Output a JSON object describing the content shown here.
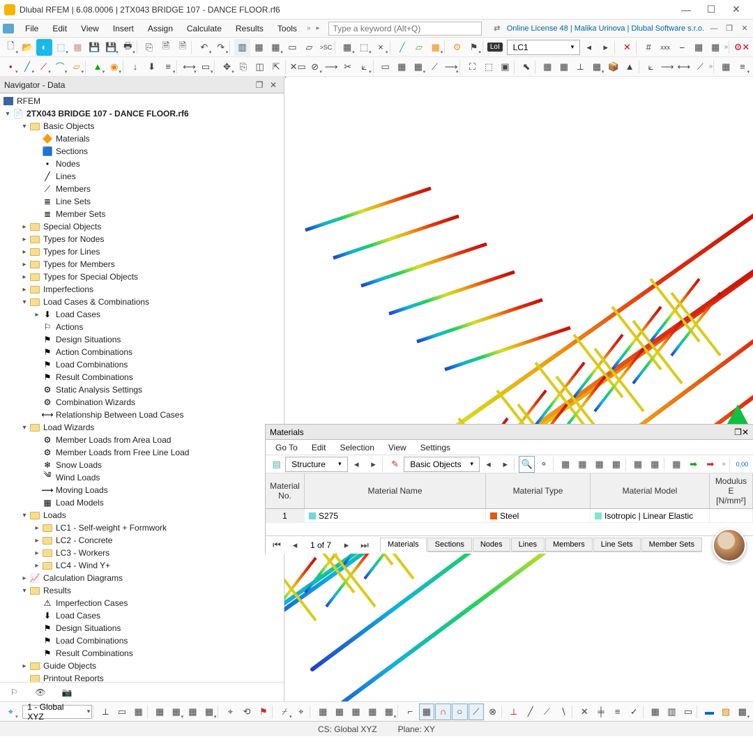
{
  "title": "Dlubal RFEM | 6.08.0006 | 2TX043 BRIDGE 107 - DANCE FLOOR.rf6",
  "menus": [
    "File",
    "Edit",
    "View",
    "Insert",
    "Assign",
    "Calculate",
    "Results",
    "Tools"
  ],
  "search_placeholder": "Type a keyword (Alt+Q)",
  "license": "Online License 48 | Malika Urinova | Dlubal Software s.r.o.",
  "lc_combo": "LC1",
  "navigator": {
    "title": "Navigator - Data",
    "root": "RFEM",
    "project": "2TX043 BRIDGE 107 - DANCE FLOOR.rf6",
    "tree": [
      {
        "d": 1,
        "tw": "▾",
        "ic": "folder",
        "t": "Basic Objects"
      },
      {
        "d": 2,
        "tw": "",
        "ic": "mat",
        "t": "Materials"
      },
      {
        "d": 2,
        "tw": "",
        "ic": "sec",
        "t": "Sections"
      },
      {
        "d": 2,
        "tw": "",
        "ic": "node",
        "t": "Nodes"
      },
      {
        "d": 2,
        "tw": "",
        "ic": "line",
        "t": "Lines"
      },
      {
        "d": 2,
        "tw": "",
        "ic": "memb",
        "t": "Members"
      },
      {
        "d": 2,
        "tw": "",
        "ic": "lset",
        "t": "Line Sets"
      },
      {
        "d": 2,
        "tw": "",
        "ic": "mset",
        "t": "Member Sets"
      },
      {
        "d": 1,
        "tw": "▸",
        "ic": "folder",
        "t": "Special Objects"
      },
      {
        "d": 1,
        "tw": "▸",
        "ic": "folder",
        "t": "Types for Nodes"
      },
      {
        "d": 1,
        "tw": "▸",
        "ic": "folder",
        "t": "Types for Lines"
      },
      {
        "d": 1,
        "tw": "▸",
        "ic": "folder",
        "t": "Types for Members"
      },
      {
        "d": 1,
        "tw": "▸",
        "ic": "folder",
        "t": "Types for Special Objects"
      },
      {
        "d": 1,
        "tw": "▸",
        "ic": "folder",
        "t": "Imperfections"
      },
      {
        "d": 1,
        "tw": "▾",
        "ic": "folder",
        "t": "Load Cases & Combinations"
      },
      {
        "d": 2,
        "tw": "▸",
        "ic": "lc",
        "t": "Load Cases"
      },
      {
        "d": 2,
        "tw": "",
        "ic": "act",
        "t": "Actions"
      },
      {
        "d": 2,
        "tw": "",
        "ic": "ds",
        "t": "Design Situations"
      },
      {
        "d": 2,
        "tw": "",
        "ic": "ac",
        "t": "Action Combinations"
      },
      {
        "d": 2,
        "tw": "",
        "ic": "lcomb",
        "t": "Load Combinations"
      },
      {
        "d": 2,
        "tw": "",
        "ic": "rc",
        "t": "Result Combinations"
      },
      {
        "d": 2,
        "tw": "",
        "ic": "sas",
        "t": "Static Analysis Settings"
      },
      {
        "d": 2,
        "tw": "",
        "ic": "cw",
        "t": "Combination Wizards"
      },
      {
        "d": 2,
        "tw": "",
        "ic": "rel",
        "t": "Relationship Between Load Cases"
      },
      {
        "d": 1,
        "tw": "▾",
        "ic": "folder",
        "t": "Load Wizards"
      },
      {
        "d": 2,
        "tw": "",
        "ic": "wiz",
        "t": "Member Loads from Area Load"
      },
      {
        "d": 2,
        "tw": "",
        "ic": "wiz",
        "t": "Member Loads from Free Line Load"
      },
      {
        "d": 2,
        "tw": "",
        "ic": "snow",
        "t": "Snow Loads"
      },
      {
        "d": 2,
        "tw": "",
        "ic": "wind",
        "t": "Wind Loads"
      },
      {
        "d": 2,
        "tw": "",
        "ic": "mov",
        "t": "Moving Loads"
      },
      {
        "d": 2,
        "tw": "",
        "ic": "lm",
        "t": "Load Models"
      },
      {
        "d": 1,
        "tw": "▾",
        "ic": "folder",
        "t": "Loads"
      },
      {
        "d": 2,
        "tw": "▸",
        "ic": "folder",
        "t": "LC1 - Self-weight + Formwork"
      },
      {
        "d": 2,
        "tw": "▸",
        "ic": "folder",
        "t": "LC2 - Concrete"
      },
      {
        "d": 2,
        "tw": "▸",
        "ic": "folder",
        "t": "LC3 - Workers"
      },
      {
        "d": 2,
        "tw": "▸",
        "ic": "folder",
        "t": "LC4 - Wind Y+"
      },
      {
        "d": 1,
        "tw": "▸",
        "ic": "diag",
        "t": "Calculation Diagrams"
      },
      {
        "d": 1,
        "tw": "▾",
        "ic": "folder",
        "t": "Results"
      },
      {
        "d": 2,
        "tw": "",
        "ic": "ic",
        "t": "Imperfection Cases"
      },
      {
        "d": 2,
        "tw": "",
        "ic": "lc",
        "t": "Load Cases"
      },
      {
        "d": 2,
        "tw": "",
        "ic": "ds",
        "t": "Design Situations"
      },
      {
        "d": 2,
        "tw": "",
        "ic": "lcomb",
        "t": "Load Combinations"
      },
      {
        "d": 2,
        "tw": "",
        "ic": "rc",
        "t": "Result Combinations"
      },
      {
        "d": 1,
        "tw": "▸",
        "ic": "folder",
        "t": "Guide Objects"
      },
      {
        "d": 1,
        "tw": "",
        "ic": "folder",
        "t": "Printout Reports"
      }
    ]
  },
  "materials": {
    "title": "Materials",
    "menus": [
      "Go To",
      "Edit",
      "Selection",
      "View",
      "Settings"
    ],
    "filter1": "Structure",
    "filter2": "Basic Objects",
    "headers": [
      "Material\nNo.",
      "Material Name",
      "Material\nType",
      "Material Model",
      "Modulus\nE [N/mm²]"
    ],
    "row": {
      "no": "1",
      "name": "S275",
      "type": "Steel",
      "model": "Isotropic | Linear Elastic"
    },
    "page": "1 of 7",
    "tabs": [
      "Materials",
      "Sections",
      "Nodes",
      "Lines",
      "Members",
      "Line Sets",
      "Member Sets"
    ]
  },
  "bottom": {
    "cs_combo": "1 - Global XYZ"
  },
  "status": {
    "cs": "CS: Global XYZ",
    "plane": "Plane: XY"
  }
}
